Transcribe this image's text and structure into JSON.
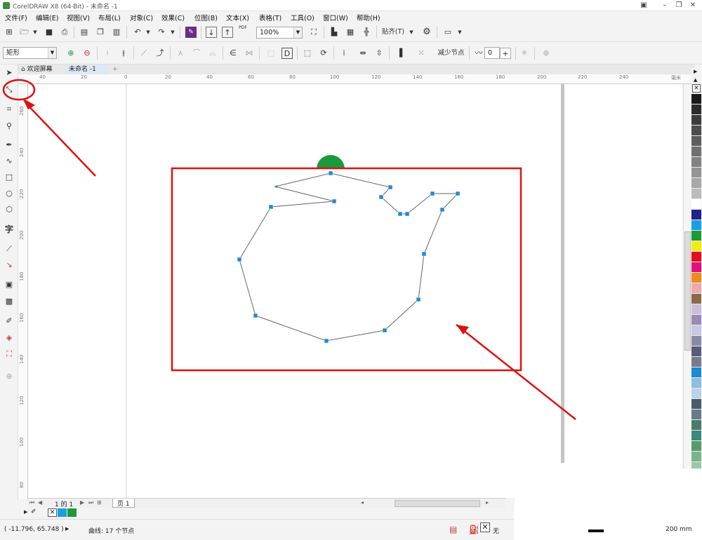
{
  "titlebar": {
    "title": "CorelDRAW X8 (64-Bit) - 未命名 -1"
  },
  "menu": [
    "文件(F)",
    "编辑(E)",
    "视图(V)",
    "布局(L)",
    "对象(C)",
    "效果(C)",
    "位图(B)",
    "文本(X)",
    "表格(T)",
    "工具(O)",
    "窗口(W)",
    "帮助(H)"
  ],
  "toolbar": {
    "zoom": "100%",
    "snap": "贴齐(T)",
    "pdf_label": "PDF"
  },
  "propbar": {
    "shape_combo": "矩形",
    "reduce_nodes": "减少节点",
    "smoothness": "0"
  },
  "tabs": {
    "welcome": "欢迎屏幕",
    "doc": "未命名 -1"
  },
  "ruler": {
    "unit": "毫米",
    "h_labels": [
      "40",
      "20",
      "0",
      "20",
      "40",
      "60",
      "80",
      "100",
      "120",
      "140",
      "160",
      "180",
      "200",
      "220",
      "240"
    ],
    "v_labels": [
      "260",
      "240",
      "220",
      "200",
      "180",
      "160",
      "140",
      "120",
      "100",
      "80"
    ]
  },
  "pagenav": {
    "page_of": "1 的 1",
    "page_tab": "页 1"
  },
  "status": {
    "coords": "( -11.796, 65.748 )",
    "info": "曲线: 17 个节点",
    "fill": "无",
    "size": "200 mm"
  },
  "colors": {
    "accent": "#1e8ad3",
    "annotation": "#e01010",
    "handle_green": "#1a9a3a"
  }
}
